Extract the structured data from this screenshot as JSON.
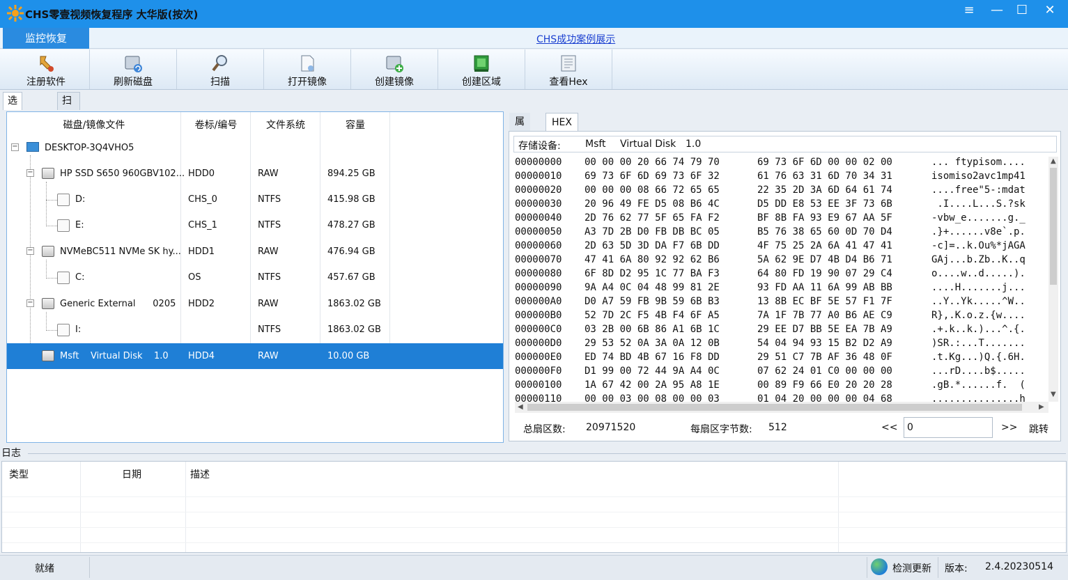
{
  "window": {
    "title": "CHS零壹视频恢复程序 大华版(按次)",
    "controls": [
      "≡",
      "—",
      "☐",
      "✕"
    ]
  },
  "menu": {
    "active_tab": "监控恢复",
    "case_link": "CHS成功案例展示"
  },
  "toolbar": {
    "items": [
      {
        "label": "注册软件",
        "icon": "register-key-icon"
      },
      {
        "label": "刷新磁盘",
        "icon": "refresh-disk-icon"
      },
      {
        "label": "扫描",
        "icon": "magnifier-icon"
      },
      {
        "label": "打开镜像",
        "icon": "open-image-icon"
      },
      {
        "label": "创建镜像",
        "icon": "create-image-icon"
      },
      {
        "label": "创建区域",
        "icon": "create-region-icon"
      },
      {
        "label": "查看Hex",
        "icon": "hex-view-icon"
      }
    ]
  },
  "left_tabs": [
    "选择磁盘",
    "扫描结果--->"
  ],
  "disk_table": {
    "headers": [
      "磁盘/镜像文件",
      "卷标/编号",
      "文件系统",
      "容量"
    ],
    "root": "DESKTOP-3Q4VHO5",
    "rows": [
      {
        "name": "HP SSD S650 960GBV102...",
        "label": "HDD0",
        "fs": "RAW",
        "size": "894.25 GB"
      },
      {
        "name": "D:",
        "label": "CHS_0",
        "fs": "NTFS",
        "size": "415.98 GB"
      },
      {
        "name": "E:",
        "label": "CHS_1",
        "fs": "NTFS",
        "size": "478.27 GB"
      },
      {
        "name": "NVMeBC511 NVMe SK hy...",
        "label": "HDD1",
        "fs": "RAW",
        "size": "476.94 GB"
      },
      {
        "name": "C:",
        "label": "OS",
        "fs": "NTFS",
        "size": "457.67 GB"
      },
      {
        "name": "Generic External      0205",
        "label": "HDD2",
        "fs": "RAW",
        "size": "1863.02 GB"
      },
      {
        "name": "I:",
        "label": "",
        "fs": "NTFS",
        "size": "1863.02 GB"
      },
      {
        "name": "Msft    Virtual Disk    1.0",
        "label": "HDD4",
        "fs": "RAW",
        "size": "10.00 GB"
      }
    ]
  },
  "right_tabs": [
    "属性",
    "HEX值"
  ],
  "hex": {
    "device_label": "存储设备:",
    "device_vendor": "Msft",
    "device_model": "Virtual Disk",
    "device_rev": "1.0",
    "lines": [
      {
        "offset": "00000000",
        "bytes1": "00 00 00 20 66 74 79 70",
        "bytes2": "69 73 6F 6D 00 00 02 00",
        "ascii": "... ftypisom...."
      },
      {
        "offset": "00000010",
        "bytes1": "69 73 6F 6D 69 73 6F 32",
        "bytes2": "61 76 63 31 6D 70 34 31",
        "ascii": "isomiso2avc1mp41"
      },
      {
        "offset": "00000020",
        "bytes1": "00 00 00 08 66 72 65 65",
        "bytes2": "22 35 2D 3A 6D 64 61 74",
        "ascii": "....free\"5-:mdat"
      },
      {
        "offset": "00000030",
        "bytes1": "20 96 49 FE D5 08 B6 4C",
        "bytes2": "D5 DD E8 53 EE 3F 73 6B",
        "ascii": " .I....L...S.?sk"
      },
      {
        "offset": "00000040",
        "bytes1": "2D 76 62 77 5F 65 FA F2",
        "bytes2": "BF 8B FA 93 E9 67 AA 5F",
        "ascii": "-vbw_e.......g._"
      },
      {
        "offset": "00000050",
        "bytes1": "A3 7D 2B D0 FB DB BC 05",
        "bytes2": "B5 76 38 65 60 0D 70 D4",
        "ascii": ".}+......v8e`.p."
      },
      {
        "offset": "00000060",
        "bytes1": "2D 63 5D 3D DA F7 6B DD",
        "bytes2": "4F 75 25 2A 6A 41 47 41",
        "ascii": "-c]=..k.Ou%*jAGA"
      },
      {
        "offset": "00000070",
        "bytes1": "47 41 6A 80 92 92 62 B6",
        "bytes2": "5A 62 9E D7 4B D4 B6 71",
        "ascii": "GAj...b.Zb..K..q"
      },
      {
        "offset": "00000080",
        "bytes1": "6F 8D D2 95 1C 77 BA F3",
        "bytes2": "64 80 FD 19 90 07 29 C4",
        "ascii": "o....w..d.....)."
      },
      {
        "offset": "00000090",
        "bytes1": "9A A4 0C 04 48 99 81 2E",
        "bytes2": "93 FD AA 11 6A 99 AB BB",
        "ascii": "....H.......j..."
      },
      {
        "offset": "000000A0",
        "bytes1": "D0 A7 59 FB 9B 59 6B B3",
        "bytes2": "13 8B EC BF 5E 57 F1 7F",
        "ascii": "..Y..Yk.....^W.."
      },
      {
        "offset": "000000B0",
        "bytes1": "52 7D 2C F5 4B F4 6F A5",
        "bytes2": "7A 1F 7B 77 A0 B6 AE C9",
        "ascii": "R},.K.o.z.{w...."
      },
      {
        "offset": "000000C0",
        "bytes1": "03 2B 00 6B 86 A1 6B 1C",
        "bytes2": "29 EE D7 BB 5E EA 7B A9",
        "ascii": ".+.k..k.)...^.{."
      },
      {
        "offset": "000000D0",
        "bytes1": "29 53 52 0A 3A 0A 12 0B",
        "bytes2": "54 04 94 93 15 B2 D2 A9",
        "ascii": ")SR.:...T......."
      },
      {
        "offset": "000000E0",
        "bytes1": "ED 74 BD 4B 67 16 F8 DD",
        "bytes2": "29 51 C7 7B AF 36 48 0F",
        "ascii": ".t.Kg...)Q.{.6H."
      },
      {
        "offset": "000000F0",
        "bytes1": "D1 99 00 72 44 9A A4 0C",
        "bytes2": "07 62 24 01 C0 00 00 00",
        "ascii": "...rD....b$....."
      },
      {
        "offset": "00000100",
        "bytes1": "1A 67 42 00 2A 95 A8 1E",
        "bytes2": "00 89 F9 66 E0 20 20 28",
        "ascii": ".gB.*......f.  ("
      },
      {
        "offset": "00000110",
        "bytes1": "00 00 03 00 08 00 00 03",
        "bytes2": "01 04 20 00 00 00 04 68",
        "ascii": "...............h"
      }
    ],
    "total_sectors_label": "总扇区数:",
    "total_sectors": "20971520",
    "bytes_per_sector_label": "每扇区字节数:",
    "bytes_per_sector": "512",
    "prev": "<<",
    "jump_value": "0",
    "next": ">>",
    "jump": "跳转"
  },
  "log": {
    "title": "日志",
    "headers": [
      "类型",
      "日期",
      "描述"
    ]
  },
  "status": {
    "ready": "就绪",
    "check_update": "检测更新",
    "version_label": "版本:",
    "version": "2.4.20230514"
  }
}
